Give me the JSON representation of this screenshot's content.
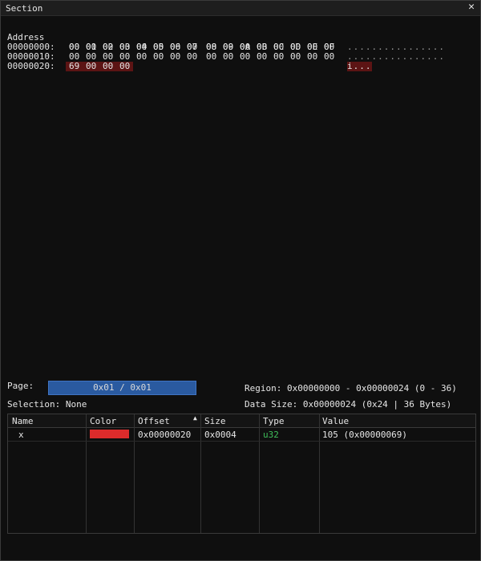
{
  "window": {
    "title": "Section",
    "close_icon": "close-icon"
  },
  "hex_header": {
    "address_label": "Address",
    "columns": [
      "00",
      "01",
      "02",
      "03",
      "04",
      "05",
      "06",
      "07",
      "08",
      "09",
      "0A",
      "0B",
      "0C",
      "0D",
      "0E",
      "0F"
    ]
  },
  "hex_rows": [
    {
      "address": "00000000:",
      "bytes": [
        "00",
        "00",
        "00",
        "00",
        "00",
        "00",
        "00",
        "00",
        "00",
        "00",
        "00",
        "00",
        "00",
        "00",
        "00",
        "00"
      ],
      "ascii": "................"
    },
    {
      "address": "00000010:",
      "bytes": [
        "00",
        "00",
        "00",
        "00",
        "00",
        "00",
        "00",
        "00",
        "00",
        "00",
        "00",
        "00",
        "00",
        "00",
        "00",
        "00"
      ],
      "ascii": "................"
    },
    {
      "address": "00000020:",
      "bytes": [
        "69",
        "00",
        "00",
        "00"
      ],
      "ascii": "i..."
    }
  ],
  "highlight_color": "#5c1414",
  "footer": {
    "page_label": "Page:",
    "page_value": "0x01 / 0x01",
    "region": "Region: 0x00000000 - 0x00000024 (0 - 36)",
    "selection": "Selection: None",
    "data_size": "Data Size: 0x00000024 (0x24 | 36 Bytes)"
  },
  "table": {
    "columns": [
      "Name",
      "Color",
      "Offset",
      "Size",
      "Type",
      "Value"
    ],
    "sort_icon": "sort-ascending-icon",
    "rows": [
      {
        "name": "x",
        "color": "#dc2b2b",
        "offset": "0x00000020",
        "size": "0x0004",
        "type": "u32",
        "value": "105 (0x00000069)"
      }
    ]
  },
  "accent_colors": {
    "page_bar": "#2a5aa0",
    "type_text": "#3fbf5a"
  }
}
